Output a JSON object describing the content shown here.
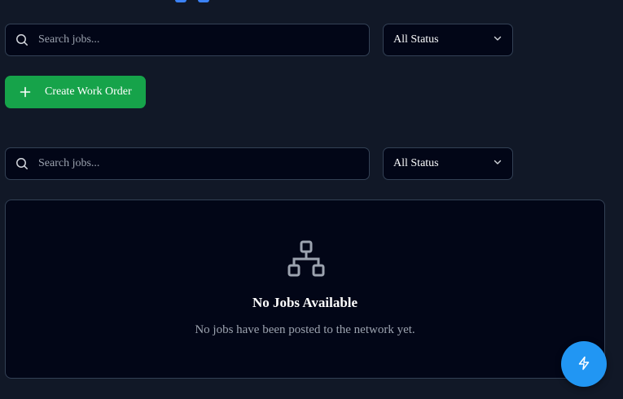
{
  "filters": [
    {
      "search_placeholder": "Search jobs...",
      "status_selected": "All Status"
    },
    {
      "search_placeholder": "Search jobs...",
      "status_selected": "All Status"
    }
  ],
  "actions": {
    "create_label": "Create Work Order"
  },
  "empty_state": {
    "title": "No Jobs Available",
    "message": "No jobs have been posted to the network yet."
  },
  "icons": {
    "search": "search-icon",
    "chevron": "chevron-down-icon",
    "plus": "plus-icon",
    "network": "network-icon",
    "fab": "lightning-icon"
  },
  "colors": {
    "background": "#111827",
    "surface": "#020617",
    "border": "#334155",
    "primary_green": "#16a34a",
    "fab_blue": "#2196f3",
    "text_muted": "#9ca3af"
  }
}
